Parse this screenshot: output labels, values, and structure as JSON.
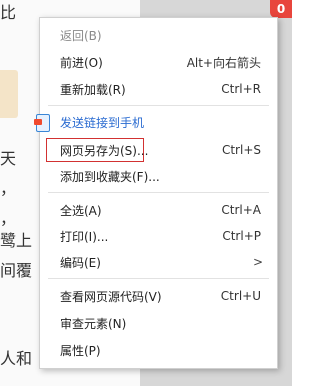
{
  "background": {
    "char_top": "比",
    "char_side": [
      "天",
      "，",
      "，",
      "鹭上",
      "间覆",
      "人和"
    ],
    "badge": "0"
  },
  "menu": {
    "items": [
      {
        "label": "返回(B)",
        "shortcut": "",
        "disabled": true
      },
      {
        "label": "前进(O)",
        "shortcut": "Alt+向右箭头",
        "disabled": false
      },
      {
        "label": "重新加载(R)",
        "shortcut": "Ctrl+R",
        "disabled": false
      },
      {
        "label": "发送链接到手机",
        "shortcut": "",
        "icon": "phone-send-icon",
        "link": true
      },
      {
        "label": "网页另存为(S)...",
        "shortcut": "Ctrl+S",
        "highlighted": true
      },
      {
        "label": "添加到收藏夹(F)...",
        "shortcut": ""
      },
      {
        "label": "全选(A)",
        "shortcut": "Ctrl+A"
      },
      {
        "label": "打印(I)...",
        "shortcut": "Ctrl+P"
      },
      {
        "label": "编码(E)",
        "shortcut": "",
        "submenu": true
      },
      {
        "label": "查看网页源代码(V)",
        "shortcut": "Ctrl+U"
      },
      {
        "label": "审查元素(N)",
        "shortcut": ""
      },
      {
        "label": "属性(P)",
        "shortcut": ""
      }
    ],
    "submenu_arrow": ">",
    "colors": {
      "link": "#2a6bd1",
      "highlight_border": "#d23131",
      "disabled": "#8a8a8a"
    }
  }
}
